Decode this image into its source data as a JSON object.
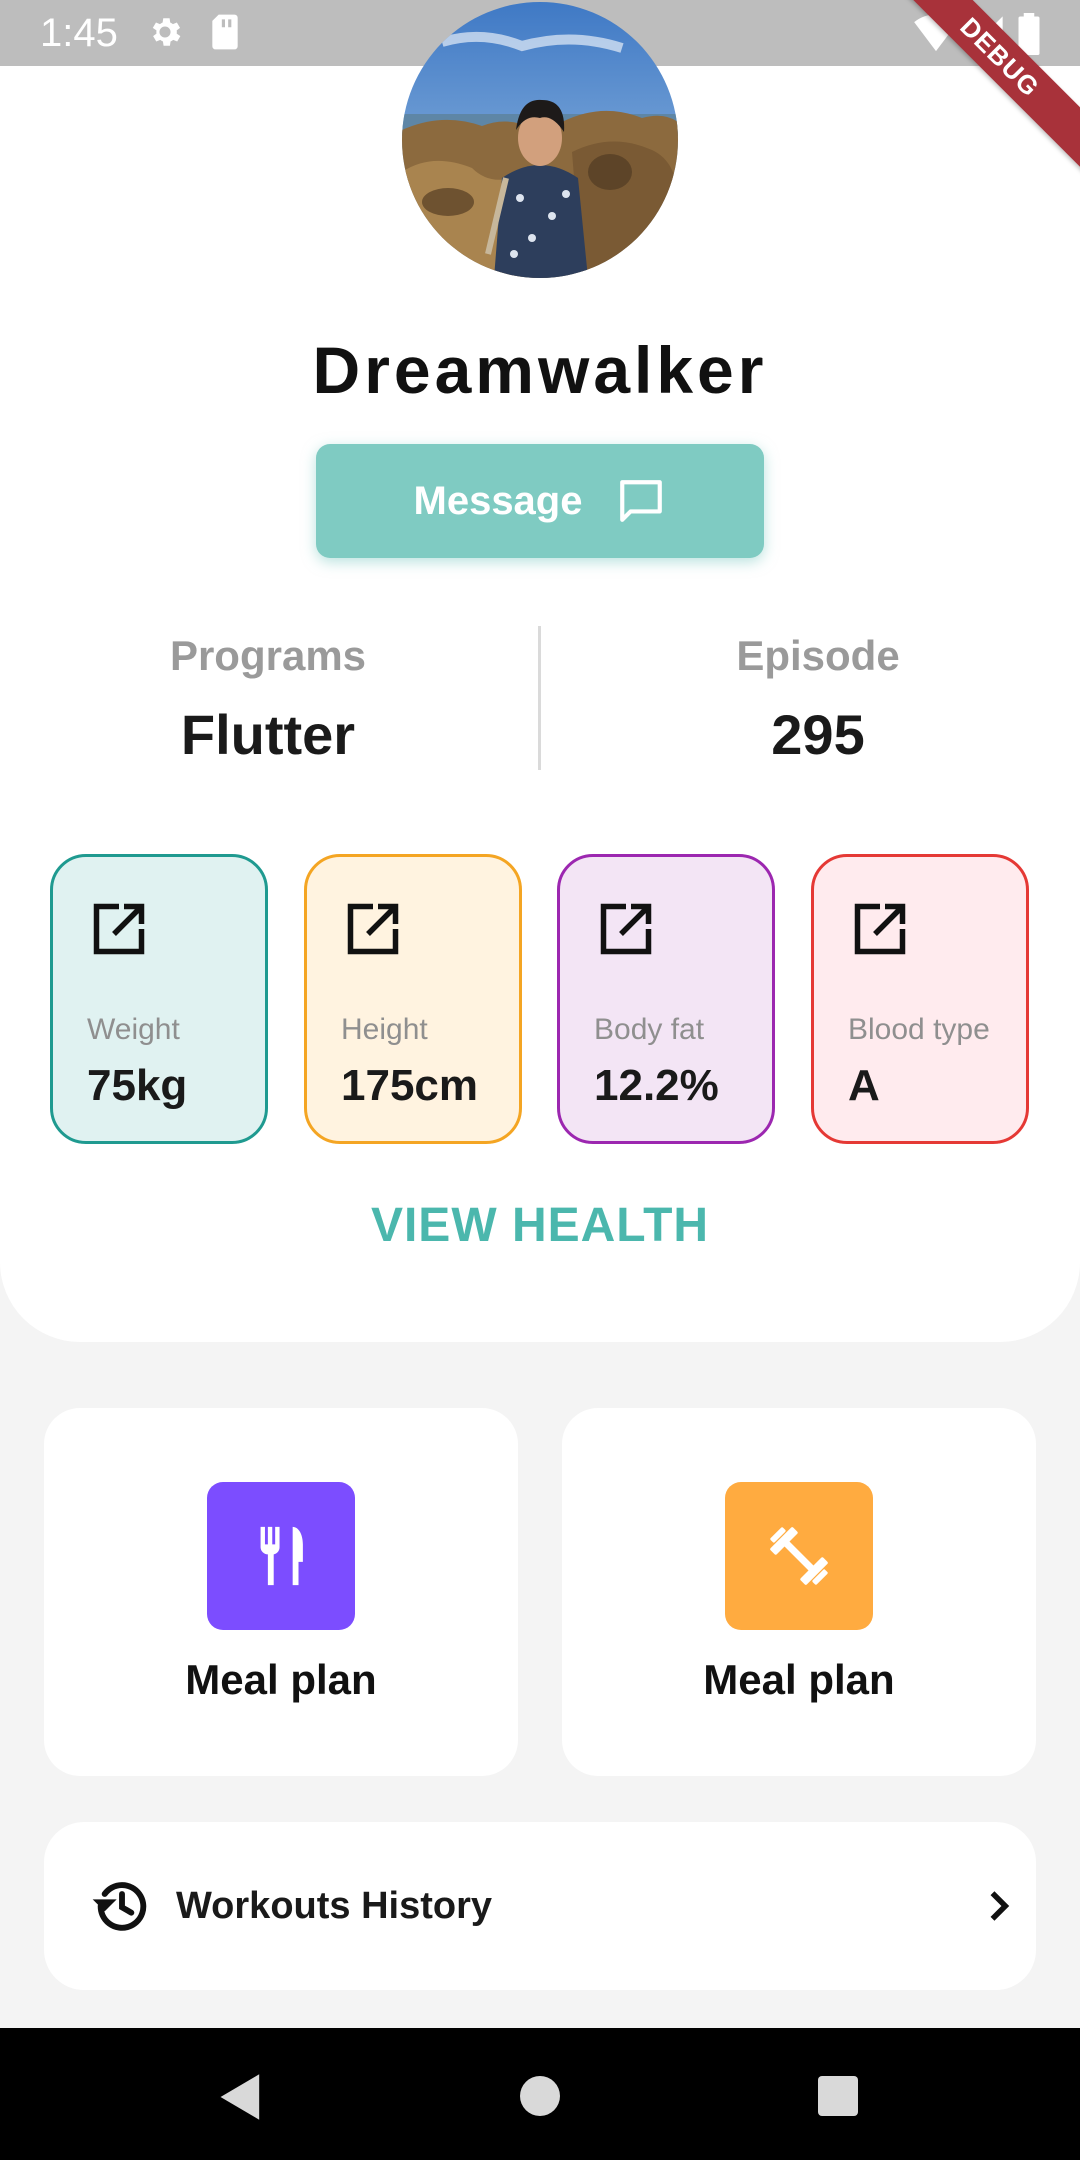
{
  "status_bar": {
    "time": "1:45",
    "icons": [
      "settings-icon",
      "sd-card-icon",
      "wifi-icon",
      "signal-icon",
      "battery-icon"
    ],
    "debug_label": "DEBUG"
  },
  "profile": {
    "name": "Dreamwalker",
    "message_button": "Message",
    "stats": [
      {
        "label": "Programs",
        "value": "Flutter"
      },
      {
        "label": "Episode",
        "value": "295"
      }
    ]
  },
  "metrics": [
    {
      "label": "Weight",
      "value": "75kg",
      "border": "#1f9a90",
      "background": "#e0f2f1",
      "icon": "open-in-new-icon"
    },
    {
      "label": "Height",
      "value": "175cm",
      "border": "#f4a523",
      "background": "#fff3e0",
      "icon": "open-in-new-icon"
    },
    {
      "label": "Body fat",
      "value": "12.2%",
      "border": "#9c27b0",
      "background": "#f3e5f5",
      "icon": "open-in-new-icon"
    },
    {
      "label": "Blood type",
      "value": "A",
      "border": "#e53935",
      "background": "#ffebee",
      "icon": "open-in-new-icon"
    }
  ],
  "view_health": "VIEW HEALTH",
  "tiles": [
    {
      "label": "Meal plan",
      "icon": "restaurant-icon",
      "color": "#7c4dff"
    },
    {
      "label": "Meal plan",
      "icon": "fitness-icon",
      "color": "#ffab40"
    }
  ],
  "history": {
    "label": "Workouts History",
    "icon": "history-icon"
  },
  "colors": {
    "accent": "#7fcbc2",
    "accent_text": "#4bb7ad"
  }
}
